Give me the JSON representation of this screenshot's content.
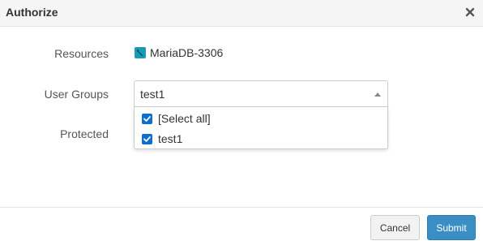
{
  "dialog": {
    "title": "Authorize",
    "close_icon": "close-icon"
  },
  "form": {
    "resources_label": "Resources",
    "resource_name": "MariaDB-3306",
    "resource_icon": "mariadb-icon",
    "user_groups_label": "User Groups",
    "user_groups_value": "test1",
    "protected_label": "Protected"
  },
  "dropdown": {
    "options": [
      {
        "label": "[Select all]",
        "checked": true
      },
      {
        "label": "test1",
        "checked": true
      }
    ]
  },
  "footer": {
    "cancel_label": "Cancel",
    "submit_label": "Submit"
  },
  "colors": {
    "accent": "#3b8ec4",
    "checkbox": "#0b6fd0",
    "db_icon": "#1a9ab5"
  }
}
